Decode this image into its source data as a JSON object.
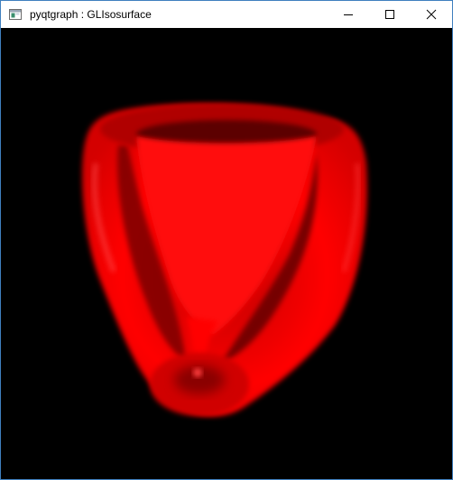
{
  "window": {
    "title": "pyqtgraph : GLIsosurface",
    "app_icon": "window-app-icon",
    "controls": [
      {
        "name": "minimize-icon"
      },
      {
        "name": "maximize-icon"
      },
      {
        "name": "close-icon"
      }
    ]
  },
  "viewport": {
    "background": "#000000",
    "surface_color": "#ff0000"
  }
}
